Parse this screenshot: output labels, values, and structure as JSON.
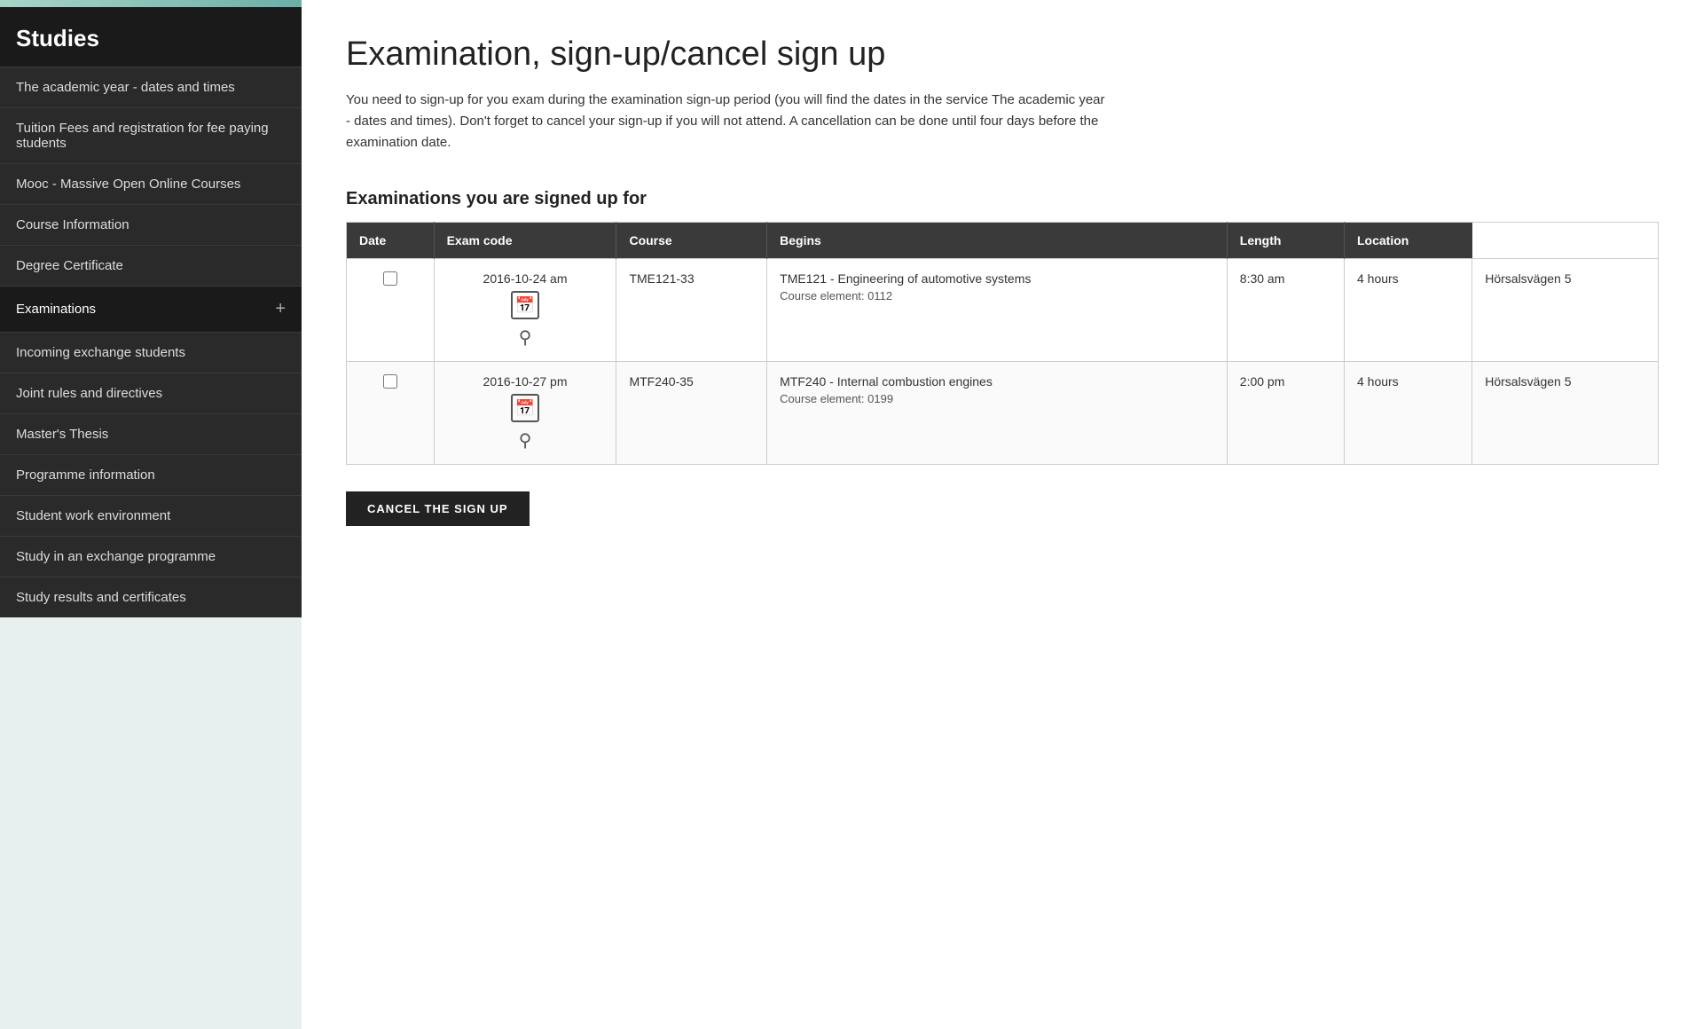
{
  "sidebar": {
    "title": "Studies",
    "items": [
      {
        "id": "academic-year",
        "label": "The academic year - dates and times",
        "active": false,
        "has_plus": false
      },
      {
        "id": "tuition-fees",
        "label": "Tuition Fees and registration for fee paying students",
        "active": false,
        "has_plus": false
      },
      {
        "id": "mooc",
        "label": "Mooc - Massive Open Online Courses",
        "active": false,
        "has_plus": false
      },
      {
        "id": "course-info",
        "label": "Course Information",
        "active": false,
        "has_plus": false
      },
      {
        "id": "degree-cert",
        "label": "Degree Certificate",
        "active": false,
        "has_plus": false
      },
      {
        "id": "examinations",
        "label": "Examinations",
        "active": true,
        "has_plus": true
      },
      {
        "id": "incoming-exchange",
        "label": "Incoming exchange students",
        "active": false,
        "has_plus": false
      },
      {
        "id": "joint-rules",
        "label": "Joint rules and directives",
        "active": false,
        "has_plus": false
      },
      {
        "id": "masters-thesis",
        "label": "Master's Thesis",
        "active": false,
        "has_plus": false
      },
      {
        "id": "programme-info",
        "label": "Programme information",
        "active": false,
        "has_plus": false
      },
      {
        "id": "student-work",
        "label": "Student work environment",
        "active": false,
        "has_plus": false
      },
      {
        "id": "exchange-programme",
        "label": "Study in an exchange programme",
        "active": false,
        "has_plus": false
      },
      {
        "id": "study-results",
        "label": "Study results and certificates",
        "active": false,
        "has_plus": false
      }
    ]
  },
  "main": {
    "page_title": "Examination, sign-up/cancel sign up",
    "description": "You need to sign-up for you exam during the examination sign-up period (you will find the dates in the service The academic year - dates and times). Don't forget to cancel your sign-up if you will not attend. A cancellation can be done until four days before the examination date.",
    "section_title": "Examinations you are signed up for",
    "table": {
      "headers": [
        "Date",
        "Exam code",
        "Course",
        "Begins",
        "Length",
        "Location"
      ],
      "rows": [
        {
          "date_text": "2016-10-24 am",
          "exam_code": "TME121-33",
          "course_name": "TME121 - Engineering of automotive systems",
          "course_element": "Course element: 0112",
          "begins": "8:30 am",
          "length": "4 hours",
          "location": "Hörsalsvägen 5"
        },
        {
          "date_text": "2016-10-27 pm",
          "exam_code": "MTF240-35",
          "course_name": "MTF240 - Internal combustion engines",
          "course_element": "Course element: 0199",
          "begins": "2:00 pm",
          "length": "4 hours",
          "location": "Hörsalsvägen 5"
        }
      ]
    },
    "cancel_button_label": "CANCEL THE SIGN UP"
  }
}
